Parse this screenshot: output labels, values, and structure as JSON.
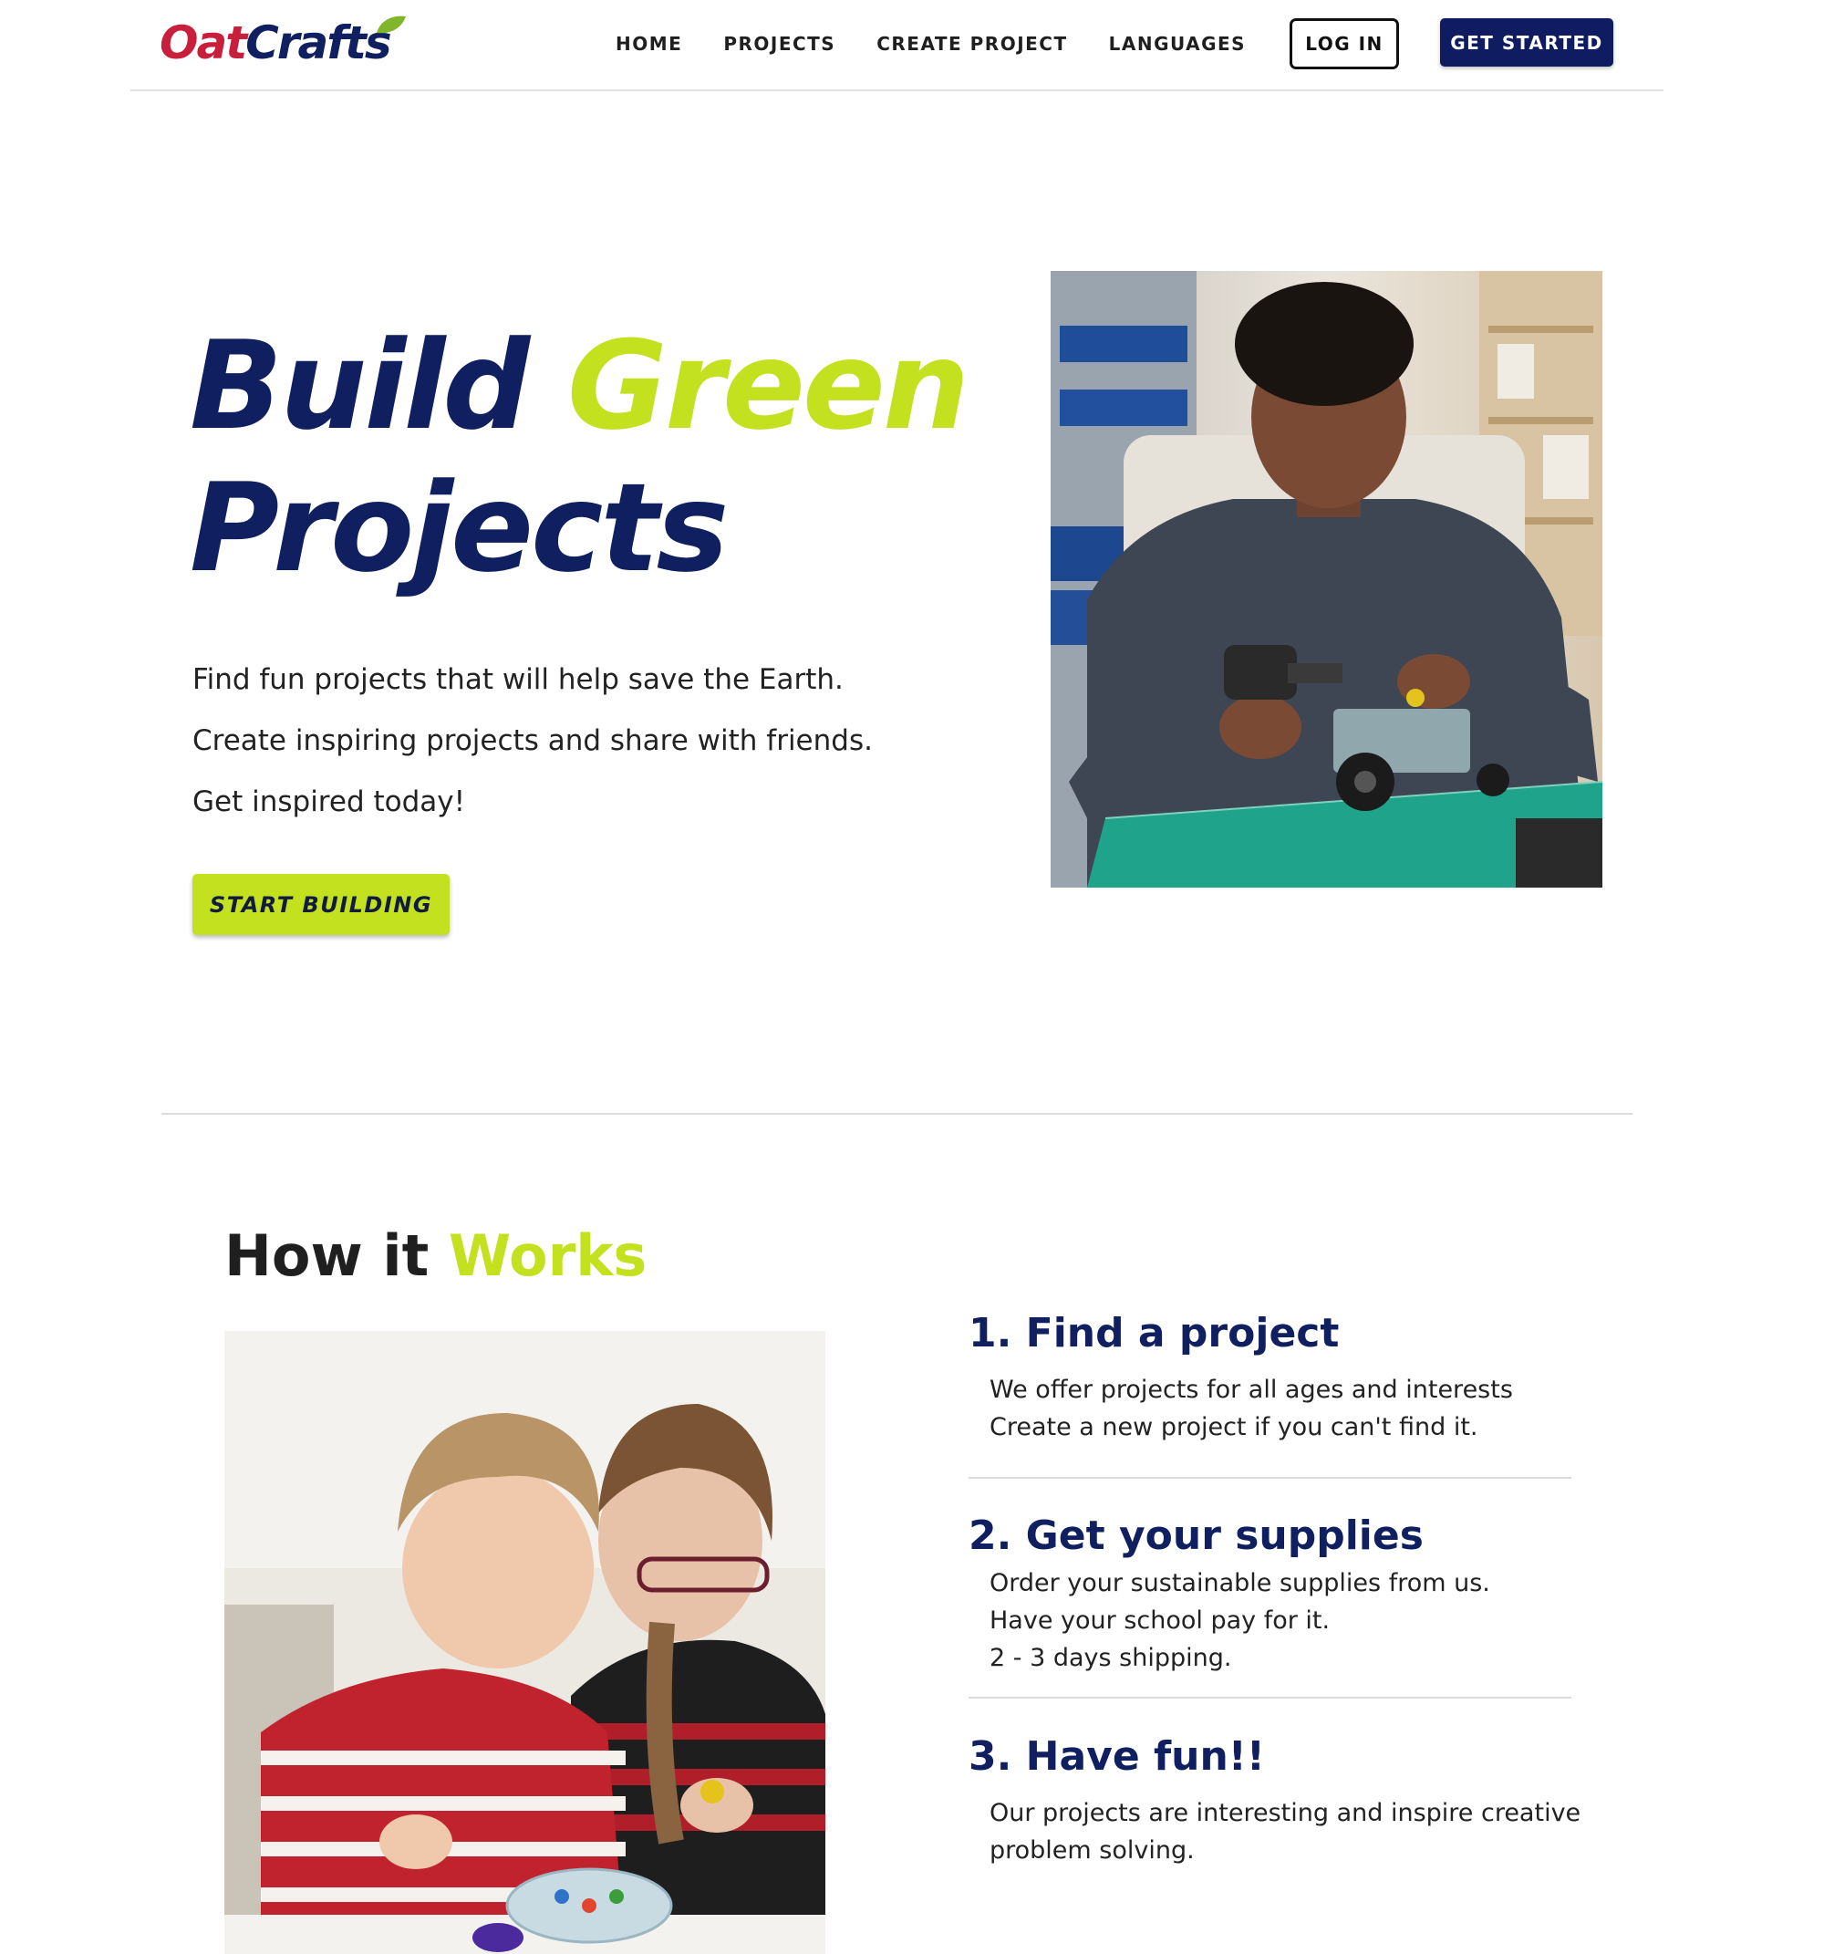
{
  "header": {
    "logo_part1": "Oat",
    "logo_part2": "Crafts",
    "nav": [
      {
        "label": "HOME"
      },
      {
        "label": "PROJECTS"
      },
      {
        "label": "CREATE PROJECT"
      },
      {
        "label": "LANGUAGES"
      }
    ],
    "login_label": "LOG IN",
    "get_started_label": "GET STARTED"
  },
  "hero": {
    "title_word1": "Build",
    "title_word2": "Green",
    "title_word3": "Projects",
    "lines": [
      "Find fun projects that will help save the Earth.",
      "Create inspiring projects and share with friends.",
      "Get inspired today!"
    ],
    "cta_label": "START BUILDING"
  },
  "how": {
    "title_part1": "How it",
    "title_part2": "Works",
    "steps": [
      {
        "title": "1. Find a project",
        "lines": [
          "We offer projects for all ages and interests",
          "Create a new project if you can't find it."
        ]
      },
      {
        "title": "2. Get your supplies",
        "lines": [
          "Order your sustainable supplies from us.",
          "Have your school pay for it.",
          "2 - 3 days shipping."
        ]
      },
      {
        "title": "3. Have fun!!",
        "lines": [
          "Our projects are interesting and inspire creative",
          "problem solving."
        ]
      }
    ]
  },
  "colors": {
    "navy": "#101f5f",
    "lime": "#c3e11e",
    "brand_red": "#c8203c"
  }
}
